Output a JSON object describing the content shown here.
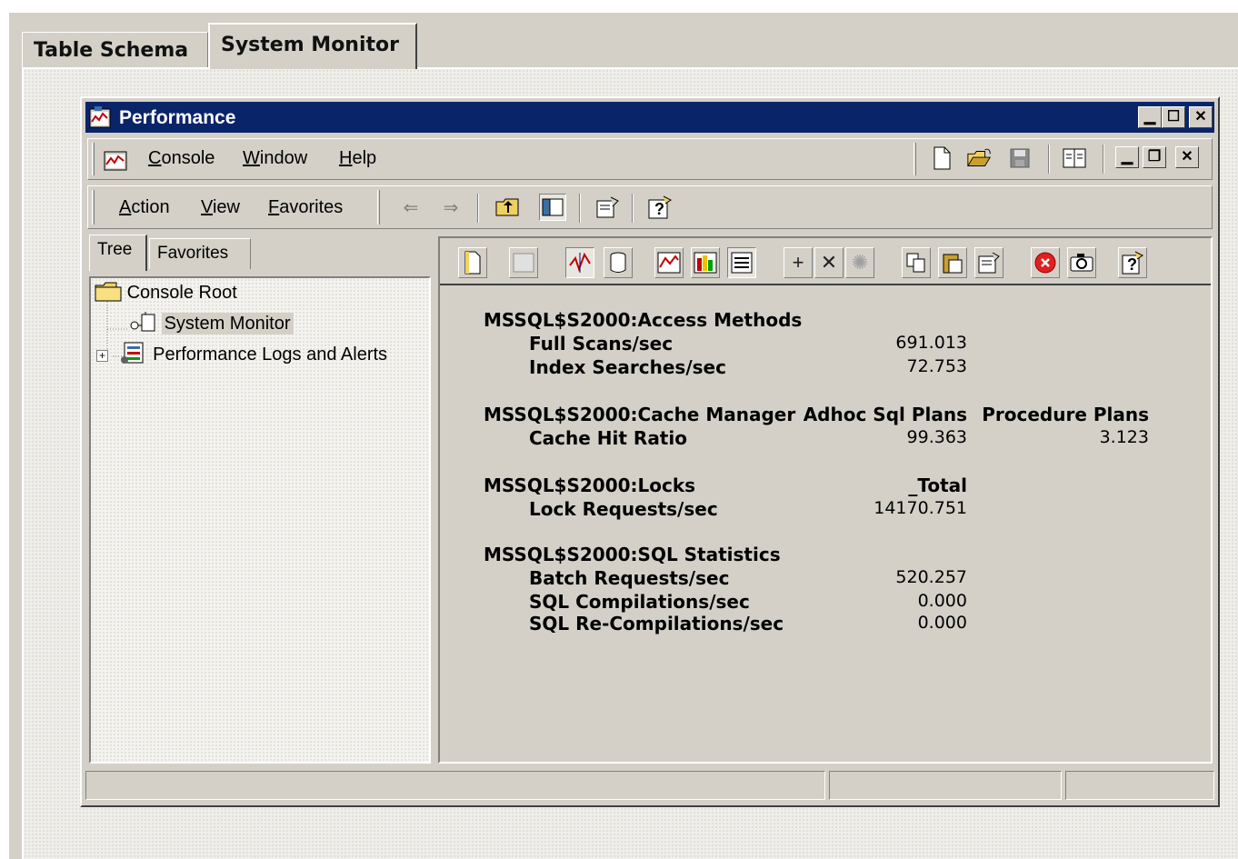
{
  "outer_tabs": [
    {
      "label": "Table Schema",
      "active": false
    },
    {
      "label": "System Monitor",
      "active": true
    }
  ],
  "window": {
    "title": "Performance",
    "controls": [
      "minimize-icon",
      "maximize-icon",
      "close-icon"
    ]
  },
  "console_menu": {
    "items": [
      {
        "label": "Console",
        "accel": "C",
        "rest": "onsole"
      },
      {
        "label": "Window",
        "accel": "W",
        "rest": "indow"
      },
      {
        "label": "Help",
        "accel": "H",
        "rest": "elp"
      }
    ],
    "toolbar_icons": [
      "new-document-icon",
      "open-folder-icon",
      "save-icon",
      "show-hide-tree-icon"
    ],
    "child_controls": [
      "minimize-icon",
      "restore-icon",
      "close-icon"
    ]
  },
  "action_menu": {
    "items": [
      {
        "label": "Action",
        "accel": "A",
        "rest": "ction"
      },
      {
        "label": "View",
        "accel": "V",
        "rest": "iew"
      },
      {
        "label": "Favorites",
        "accel": "F",
        "rest": "avorites"
      }
    ],
    "toolbar_icons": [
      "back-arrow-icon",
      "forward-arrow-icon",
      "up-one-level-icon",
      "show-hide-console-tree-icon",
      "properties-icon",
      "help-icon"
    ]
  },
  "left_tabs": [
    {
      "label": "Tree",
      "active": true
    },
    {
      "label": "Favorites",
      "active": false
    }
  ],
  "tree": {
    "root": "Console Root",
    "children": [
      {
        "label": "System Monitor",
        "selected": true,
        "icon": "system-monitor-icon"
      },
      {
        "label": "Performance Logs and Alerts",
        "selected": false,
        "icon": "performance-logs-icon",
        "expander": "+"
      }
    ]
  },
  "sysmon_toolbar": [
    "new-counter-set-icon",
    "clear-display-icon",
    "view-current-activity-icon",
    "view-log-data-icon",
    "view-graph-icon",
    "view-histogram-icon",
    "view-report-icon",
    "add-counter-icon",
    "delete-counter-icon",
    "highlight-icon",
    "copy-properties-icon",
    "paste-counter-list-icon",
    "properties-icon",
    "freeze-display-icon",
    "update-data-icon",
    "help-icon"
  ],
  "report": {
    "sections": [
      {
        "object": "MSSQL$S2000:Access Methods",
        "instances": [],
        "counters": [
          {
            "name": "Full Scans/sec",
            "values": [
              "691.013"
            ]
          },
          {
            "name": "Index Searches/sec",
            "values": [
              "72.753"
            ]
          }
        ]
      },
      {
        "object": "MSSQL$S2000:Cache Manager",
        "instances": [
          "Adhoc Sql Plans",
          "Procedure Plans"
        ],
        "counters": [
          {
            "name": "Cache Hit Ratio",
            "values": [
              "99.363",
              "3.123"
            ]
          }
        ]
      },
      {
        "object": "MSSQL$S2000:Locks",
        "instances": [
          "_Total"
        ],
        "counters": [
          {
            "name": "Lock Requests/sec",
            "values": [
              "14170.751"
            ]
          }
        ]
      },
      {
        "object": "MSSQL$S2000:SQL Statistics",
        "instances": [],
        "counters": [
          {
            "name": "Batch Requests/sec",
            "values": [
              "520.257"
            ]
          },
          {
            "name": "SQL Compilations/sec",
            "values": [
              "0.000"
            ]
          },
          {
            "name": "SQL Re-Compilations/sec",
            "values": [
              "0.000"
            ]
          }
        ]
      }
    ]
  },
  "status_bar": [
    "",
    "",
    ""
  ]
}
